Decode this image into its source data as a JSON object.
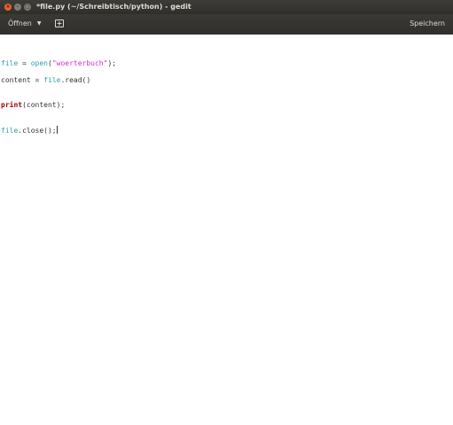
{
  "window": {
    "title": "*file.py (~/Schreibtisch/python) - gedit",
    "close_glyph": "×",
    "min_glyph": "–",
    "max_glyph": "□"
  },
  "toolbar": {
    "open_label": "Öffnen",
    "open_caret": "▼",
    "new_tab_icon": "+",
    "save_label": "Speichern"
  },
  "editor": {
    "lines": [
      [
        {
          "type": "builtin",
          "text": "file"
        },
        {
          "type": "plain",
          "text": " = "
        },
        {
          "type": "builtin",
          "text": "open"
        },
        {
          "type": "plain",
          "text": "("
        },
        {
          "type": "str",
          "text": "\"woerterbuch\""
        },
        {
          "type": "plain",
          "text": ");"
        }
      ],
      [
        {
          "type": "plain",
          "text": "content = "
        },
        {
          "type": "builtin",
          "text": "file"
        },
        {
          "type": "plain",
          "text": ".read()"
        }
      ],
      [
        {
          "type": "kw",
          "text": "print"
        },
        {
          "type": "plain",
          "text": "(content);"
        }
      ],
      [
        {
          "type": "builtin",
          "text": "file"
        },
        {
          "type": "plain",
          "text": ".close();"
        }
      ]
    ]
  },
  "colors": {
    "titlebar": "#3d3c38",
    "close_button": "#e9622f",
    "builtin": "#2aa1b3",
    "keyword": "#a40000",
    "string": "#d62bc8"
  }
}
